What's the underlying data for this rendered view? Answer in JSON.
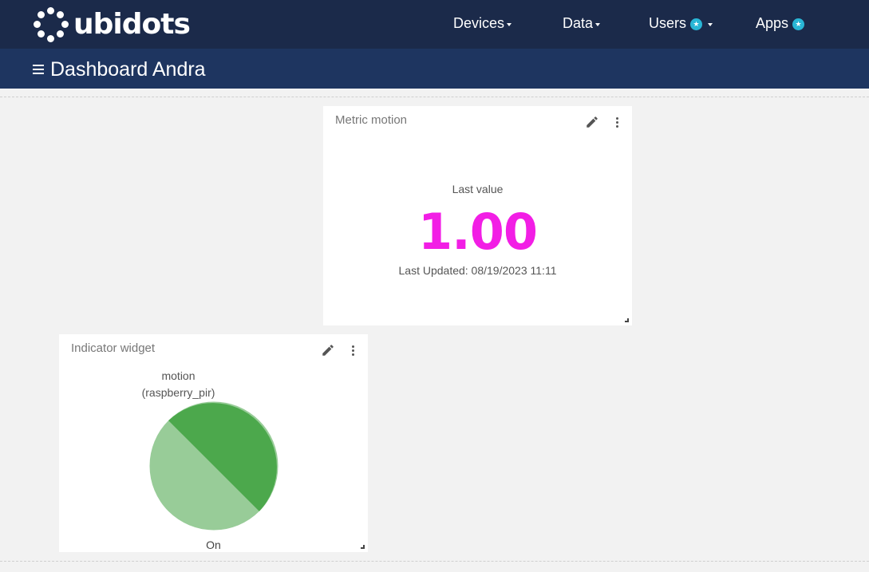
{
  "app": {
    "logo_text": "ubidots"
  },
  "nav": {
    "devices": "Devices",
    "data": "Data",
    "users": "Users",
    "apps": "Apps"
  },
  "dashboard": {
    "title": "Dashboard Andra"
  },
  "metric_widget": {
    "title": "Metric motion",
    "caption": "Last value",
    "value": "1.00",
    "updated": "Last Updated: 08/19/2023 11:11",
    "value_color": "#f21ee5"
  },
  "indicator_widget": {
    "title": "Indicator widget",
    "variable": "motion",
    "device": "(raspberry_pir)",
    "state_label": "On",
    "colors": {
      "light": "#98cc98",
      "dark": "#4ca84c"
    }
  },
  "colors": {
    "header": "#1b2a4a",
    "subheader": "#1e3560",
    "badge": "#29b6d6"
  }
}
